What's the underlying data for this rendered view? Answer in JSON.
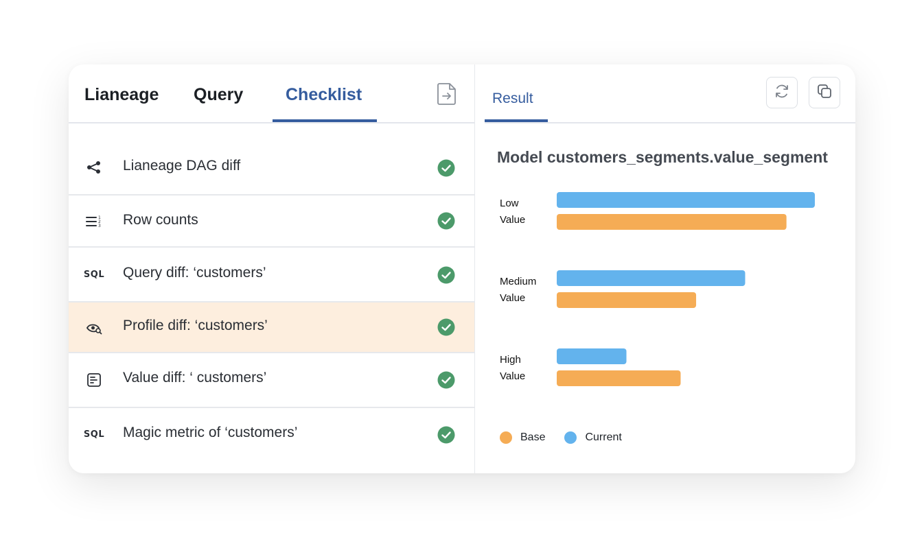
{
  "tabs": [
    {
      "label": "Lianeage"
    },
    {
      "label": "Query"
    },
    {
      "label": "Checklist"
    }
  ],
  "checklist": [
    {
      "icon": "lineage-graph-icon",
      "label": "Lianeage DAG diff",
      "status": "passed"
    },
    {
      "icon": "row-count-icon",
      "label": "Row counts",
      "status": "passed"
    },
    {
      "icon": "SQL",
      "label": "Query diff: ‘customers’",
      "status": "passed"
    },
    {
      "icon": "profile-eye-icon",
      "label": "Profile diff: ‘customers’",
      "status": "passed",
      "selected": true
    },
    {
      "icon": "value-diff-icon",
      "label": "Value diff: ‘ customers’",
      "status": "passed"
    },
    {
      "icon": "SQL",
      "label": "Magic metric of ‘customers’",
      "status": "passed"
    }
  ],
  "result_panel": {
    "tab_label": "Result",
    "buttons": [
      "refresh-icon",
      "copy-icon"
    ]
  },
  "colors": {
    "accent": "#355c9e",
    "check": "#4c9a6a",
    "highlight": "#fdeede",
    "base": "#f5ac55",
    "current": "#63b3ed"
  },
  "chart_data": {
    "type": "bar",
    "orientation": "horizontal",
    "title": "Model customers_segments.value_segment",
    "categories": [
      [
        "Low",
        "Value"
      ],
      [
        "Medium",
        "Value"
      ],
      [
        "High",
        "Value"
      ]
    ],
    "series": [
      {
        "name": "Current",
        "color": "#63b3ed",
        "values": [
          100,
          73,
          27
        ]
      },
      {
        "name": "Base",
        "color": "#f5ac55",
        "values": [
          89,
          54,
          48
        ]
      }
    ],
    "xlim": [
      0,
      100
    ],
    "grid": false,
    "legend": {
      "position": "bottom-left",
      "order": [
        "Base",
        "Current"
      ]
    }
  }
}
